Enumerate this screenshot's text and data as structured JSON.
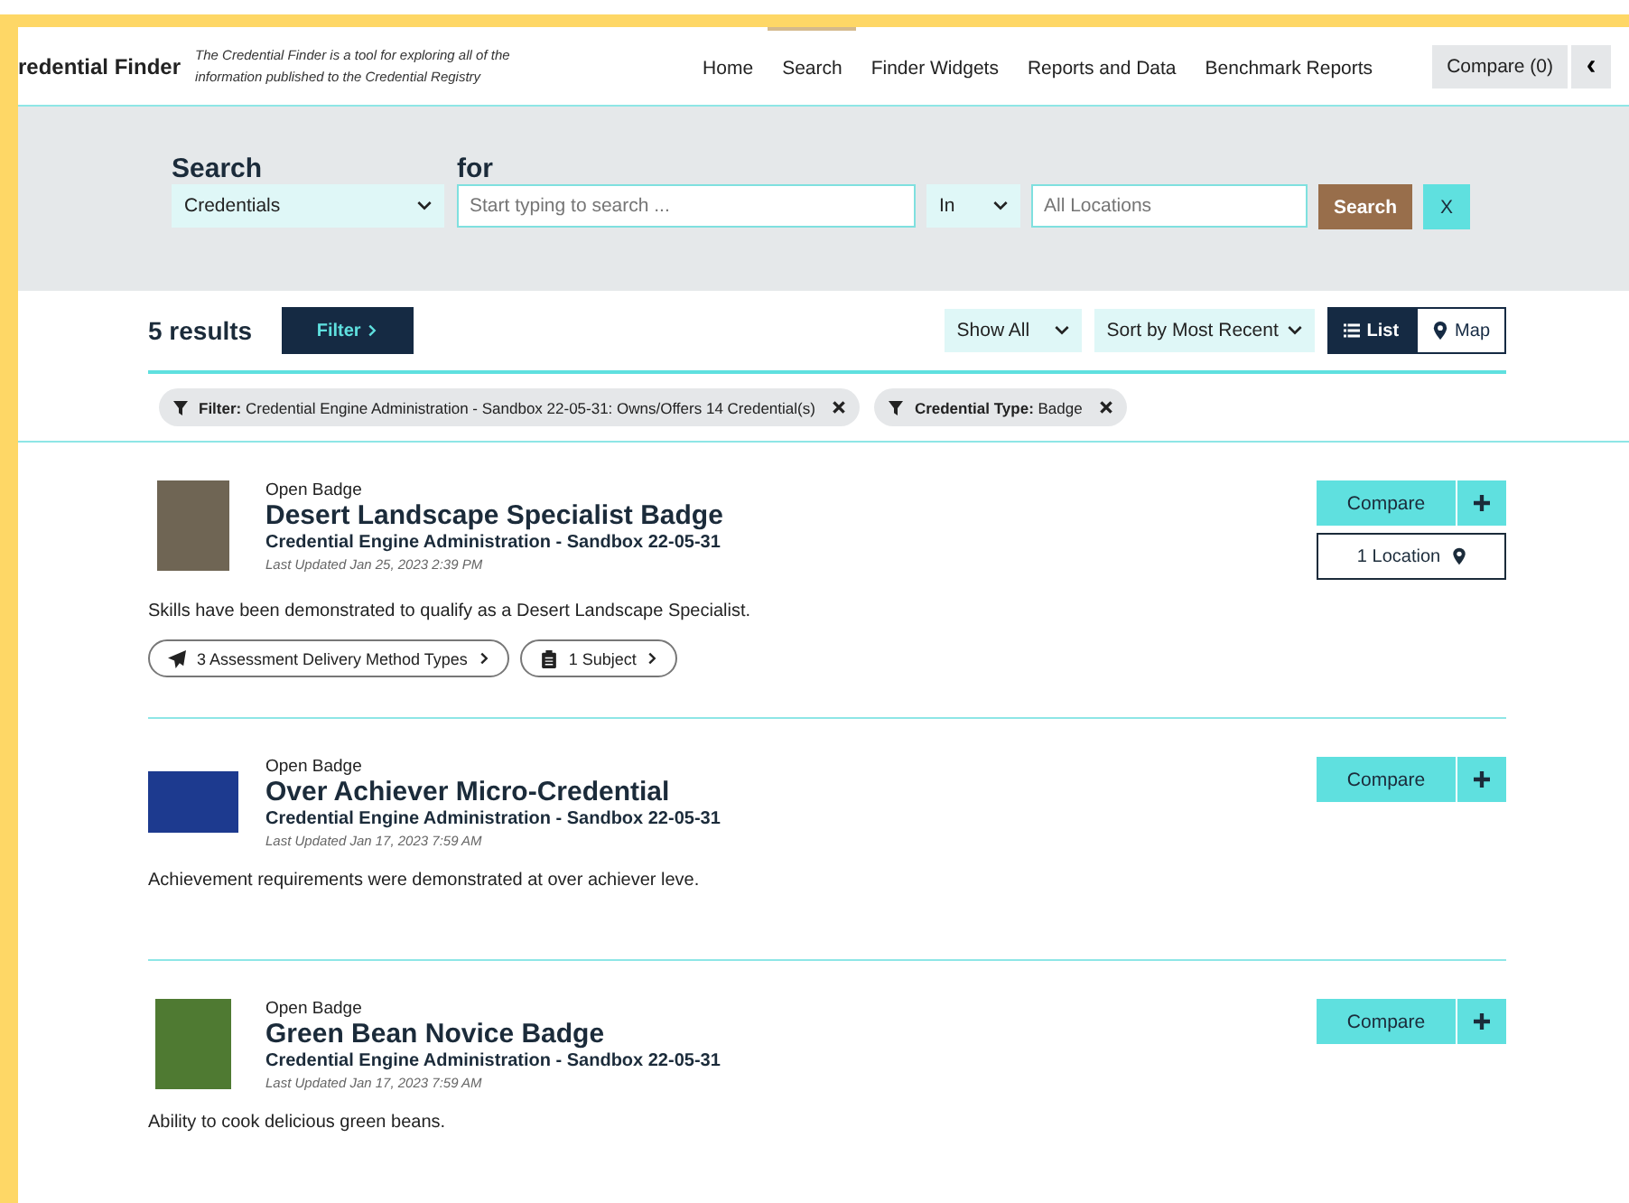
{
  "brand": {
    "name": "redential Finder",
    "tagline": "The Credential Finder is a tool for exploring all of the information published to the Credential Registry"
  },
  "nav": [
    {
      "label": "Home",
      "selected": false
    },
    {
      "label": "Search",
      "selected": true
    },
    {
      "label": "Finder Widgets",
      "selected": false
    },
    {
      "label": "Reports and Data",
      "selected": false
    },
    {
      "label": "Benchmark Reports",
      "selected": false
    }
  ],
  "compare_button": "Compare (0)",
  "collapse_button": "‹",
  "search": {
    "heading": "Search",
    "for_label": "for",
    "type": "Credentials",
    "query_placeholder": "Start typing to search ...",
    "in": "In",
    "location_placeholder": "All Locations",
    "submit": "Search",
    "clear": "X"
  },
  "results_bar": {
    "count": "5 results",
    "filter_button": "Filter",
    "show": "Show All",
    "sort": "Sort by Most Recent",
    "views": [
      {
        "label": "List",
        "selected": true
      },
      {
        "label": "Map",
        "selected": false
      }
    ]
  },
  "filters": [
    {
      "name": "Filter:",
      "value": "Credential Engine Administration - Sandbox 22-05-31: Owns/Offers 14 Credential(s)"
    },
    {
      "name": "Credential Type:",
      "value": "Badge"
    }
  ],
  "results": [
    {
      "type": "Open Badge",
      "title": "Desert Landscape Specialist Badge",
      "org": "Credential Engine Administration - Sandbox 22-05-31",
      "updated": "Last Updated Jan 25, 2023 2:39 PM",
      "description": "Skills have been demonstrated to qualify as a Desert Landscape Specialist.",
      "compare": "Compare",
      "location": "1 Location",
      "tags": [
        {
          "kind": "delivery",
          "label": "3 Assessment Delivery Method Types"
        },
        {
          "kind": "subject",
          "label": "1 Subject"
        }
      ]
    },
    {
      "type": "Open Badge",
      "title": "Over Achiever Micro-Credential",
      "org": "Credential Engine Administration - Sandbox 22-05-31",
      "updated": "Last Updated Jan 17, 2023 7:59 AM",
      "description": "Achievement requirements were demonstrated at over achiever leve.",
      "compare": "Compare"
    },
    {
      "type": "Open Badge",
      "title": "Green Bean Novice Badge",
      "org": "Credential Engine Administration - Sandbox 22-05-31",
      "updated": "Last Updated Jan 17, 2023 7:59 AM",
      "description": "Ability to cook delicious green beans.",
      "compare": "Compare"
    }
  ]
}
